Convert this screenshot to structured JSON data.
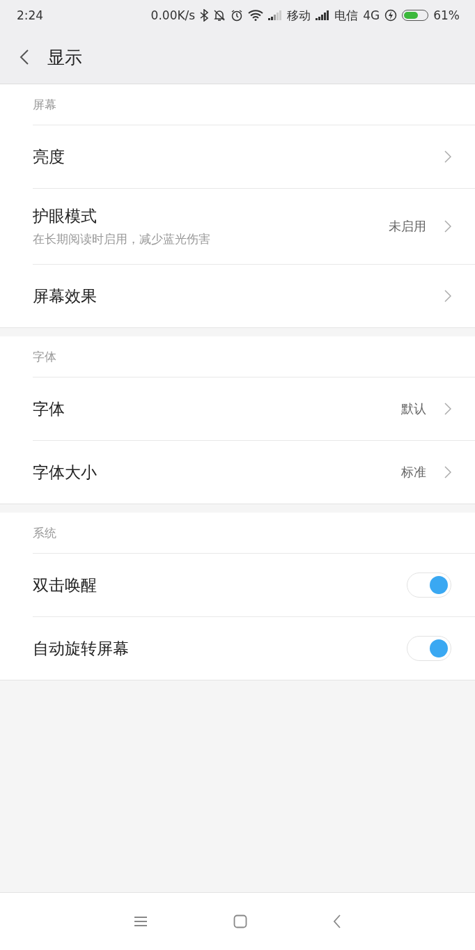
{
  "status_bar": {
    "time": "2:24",
    "speed": "0.00K/s",
    "carrier_1": "移动",
    "carrier_2": "电信",
    "network": "4G",
    "battery": "61%"
  },
  "header": {
    "title": "显示"
  },
  "sections": [
    {
      "title": "屏幕",
      "items": [
        {
          "kind": "link",
          "label": "亮度"
        },
        {
          "kind": "link",
          "label": "护眼模式",
          "subtitle": "在长期阅读时启用，减少蓝光伤害",
          "value": "未启用"
        },
        {
          "kind": "link",
          "label": "屏幕效果"
        }
      ]
    },
    {
      "title": "字体",
      "items": [
        {
          "kind": "link",
          "label": "字体",
          "value": "默认"
        },
        {
          "kind": "link",
          "label": "字体大小",
          "value": "标准"
        }
      ]
    },
    {
      "title": "系统",
      "items": [
        {
          "kind": "switch",
          "label": "双击唤醒",
          "on": true
        },
        {
          "kind": "switch",
          "label": "自动旋转屏幕",
          "on": true
        }
      ]
    }
  ]
}
